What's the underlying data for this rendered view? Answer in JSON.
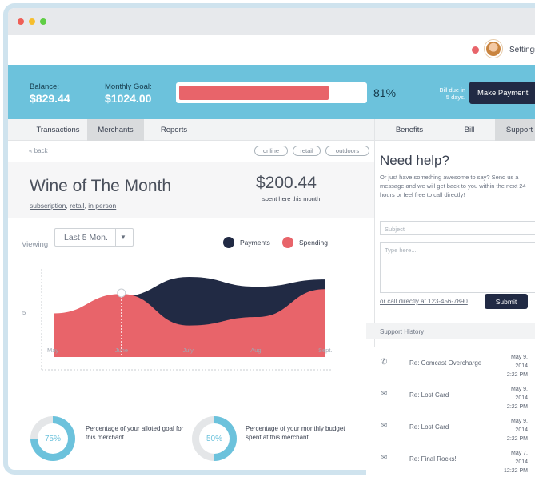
{
  "header": {
    "settings_label": "Settings"
  },
  "banner": {
    "balance_label": "Balance:",
    "balance_value": "$829.44",
    "goal_label": "Monthly Goal:",
    "goal_value": "$1024.00",
    "progress_percent": 81,
    "progress_text": "81%",
    "bill_due_line1": "Bill due in",
    "bill_due_line2": "5 days.",
    "pay_button": "Make Payment"
  },
  "tabs": [
    "Transactions",
    "Merchants",
    "Reports"
  ],
  "right_tabs": [
    "Benefits",
    "Bill",
    "Support"
  ],
  "subbar": {
    "back_label": "back",
    "chips": [
      "online",
      "retail",
      "outdoors"
    ]
  },
  "merchant": {
    "title": "Wine of The Month",
    "tags": [
      "subscription",
      "retail",
      "in person"
    ],
    "amount": "$200.44",
    "amount_caption": "spent here this month"
  },
  "controls": {
    "viewing_label": "Viewing",
    "period_value": "Last 5 Mon."
  },
  "chart_data": {
    "type": "area",
    "categories": [
      "May",
      "June",
      "July",
      "Aug.",
      "Sept."
    ],
    "ylabel_tick": "5",
    "legend_position": "top-right",
    "series": [
      {
        "name": "Payments",
        "color": "#212a44",
        "values": [
          3.2,
          5.0,
          6.6,
          5.8,
          6.4
        ]
      },
      {
        "name": "Spending",
        "color": "#e8646a",
        "values": [
          3.6,
          5.2,
          2.6,
          3.3,
          5.6
        ]
      }
    ],
    "highlight_category": "June"
  },
  "donuts": [
    {
      "percent": 75,
      "label": "75%",
      "caption": "Percentage of your alloted goal for this merchant"
    },
    {
      "percent": 50,
      "label": "50%",
      "caption": "Percentage of your monthly budget spent at this merchant"
    }
  ],
  "support": {
    "title": "Need help?",
    "subtitle": "Or just have something awesome to say? Send us a message and we will get back to you within the next 24 hours or feel free to call directly!",
    "subject_placeholder": "Subject",
    "message_placeholder": "Type here....",
    "call_link": "or call directly at 123-456-7890",
    "submit_label": "Submit",
    "history_title": "Support History",
    "history": [
      {
        "icon": "phone-icon",
        "subject": "Re: Comcast Overcharge",
        "date": "May 9, 2014",
        "time": "2:22 PM"
      },
      {
        "icon": "mail-icon",
        "subject": "Re: Lost Card",
        "date": "May 9, 2014",
        "time": "2:22 PM"
      },
      {
        "icon": "mail-icon",
        "subject": "Re: Lost Card",
        "date": "May 9, 2014",
        "time": "2:22 PM"
      },
      {
        "icon": "mail-icon",
        "subject": "Re: Final Rocks!",
        "date": "May 7, 2014",
        "time": "12:22 PM"
      }
    ]
  },
  "colors": {
    "accent_blue": "#6cc2dc",
    "accent_red": "#e8646a",
    "navy": "#212a44"
  }
}
